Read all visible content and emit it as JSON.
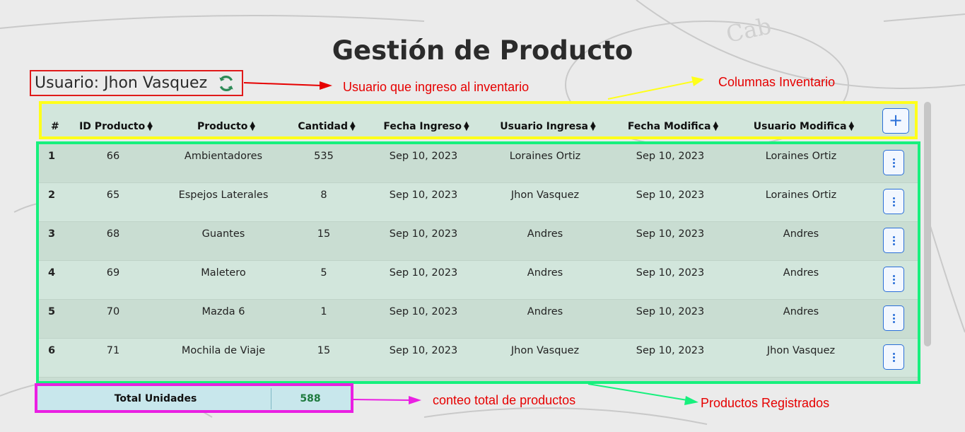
{
  "page": {
    "title": "Gestión de Producto"
  },
  "user": {
    "label": "Usuario: Jhon Vasquez",
    "icon": "refresh-icon",
    "icon_color": "#2e8b57"
  },
  "annotations": {
    "user": "Usuario que ingreso al inventario",
    "columns": "Columnas Inventario",
    "total": "conteo total de productos",
    "rows": "Productos Registrados"
  },
  "table": {
    "headers": [
      "#",
      "ID Producto",
      "Producto",
      "Cantidad",
      "Fecha Ingreso",
      "Usuario Ingresa",
      "Fecha Modifica",
      "Usuario Modifica"
    ],
    "add_icon": "plus-icon",
    "row_menu_icon": "kebab-menu-icon",
    "rows": [
      [
        "1",
        "66",
        "Ambientadores",
        "535",
        "Sep 10, 2023",
        "Loraines Ortiz",
        "Sep 10, 2023",
        "Loraines Ortiz"
      ],
      [
        "2",
        "65",
        "Espejos Laterales",
        "8",
        "Sep 10, 2023",
        "Jhon Vasquez",
        "Sep 10, 2023",
        "Loraines Ortiz"
      ],
      [
        "3",
        "68",
        "Guantes",
        "15",
        "Sep 10, 2023",
        "Andres",
        "Sep 10, 2023",
        "Andres"
      ],
      [
        "4",
        "69",
        "Maletero",
        "5",
        "Sep 10, 2023",
        "Andres",
        "Sep 10, 2023",
        "Andres"
      ],
      [
        "5",
        "70",
        "Mazda 6",
        "1",
        "Sep 10, 2023",
        "Andres",
        "Sep 10, 2023",
        "Andres"
      ],
      [
        "6",
        "71",
        "Mochila de Viaje",
        "15",
        "Sep 10, 2023",
        "Jhon Vasquez",
        "Sep 10, 2023",
        "Jhon Vasquez"
      ]
    ]
  },
  "total": {
    "label": "Total Unidades",
    "value": "588"
  },
  "colors": {
    "user_box": "#e01a1a",
    "header_box": "#ffff1a",
    "rows_box": "#17f07d",
    "total_box": "#ea1fe2",
    "accent": "#2a6fd8"
  }
}
